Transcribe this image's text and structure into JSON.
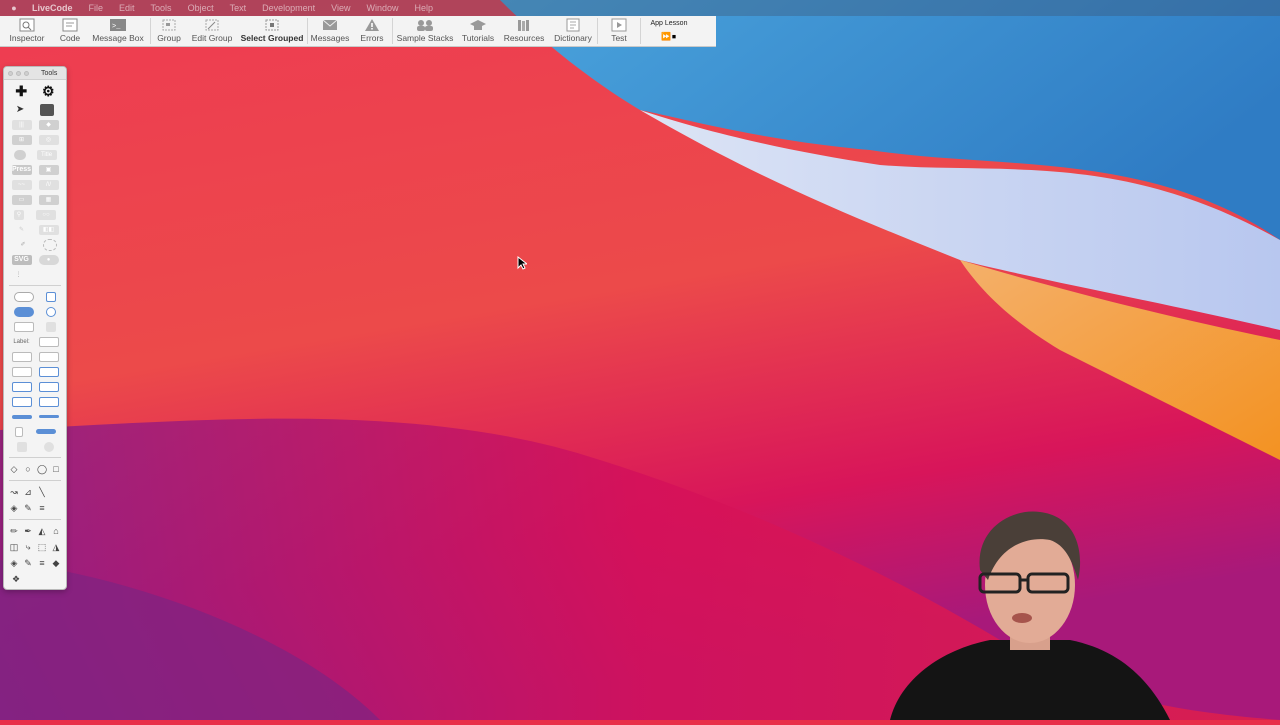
{
  "menubar": {
    "apple_icon": "apple-logo-icon",
    "items": [
      "LiveCode",
      "File",
      "Edit",
      "Tools",
      "Object",
      "Text",
      "Development",
      "View",
      "Window",
      "Help"
    ]
  },
  "toolbar": {
    "buttons": [
      {
        "label": "Inspector",
        "icon": "inspector-icon"
      },
      {
        "label": "Code",
        "icon": "code-icon"
      },
      {
        "label": "Message Box",
        "icon": "message-box-icon"
      },
      {
        "label": "Group",
        "icon": "group-icon"
      },
      {
        "label": "Edit Group",
        "icon": "edit-group-icon"
      },
      {
        "label": "Select Grouped",
        "icon": "select-grouped-icon"
      },
      {
        "label": "Messages",
        "icon": "messages-icon"
      },
      {
        "label": "Errors",
        "icon": "errors-icon"
      },
      {
        "label": "Sample Stacks",
        "icon": "sample-stacks-icon"
      },
      {
        "label": "Tutorials",
        "icon": "tutorials-icon"
      },
      {
        "label": "Resources",
        "icon": "resources-icon"
      },
      {
        "label": "Dictionary",
        "icon": "dictionary-icon"
      },
      {
        "label": "Test",
        "icon": "test-icon"
      }
    ],
    "app_lesson": {
      "label": "App Lesson",
      "controls": "⏩⏹"
    }
  },
  "tools_palette": {
    "title": "Tools",
    "press_label": "Press",
    "svg_label": "SVG",
    "label_label": "Label:"
  },
  "colors": {
    "wallpaper_red": "#e8304a",
    "wallpaper_blue": "#3f8fd0",
    "wallpaper_orange": "#f29a33",
    "wallpaper_magenta": "#b8145e"
  }
}
